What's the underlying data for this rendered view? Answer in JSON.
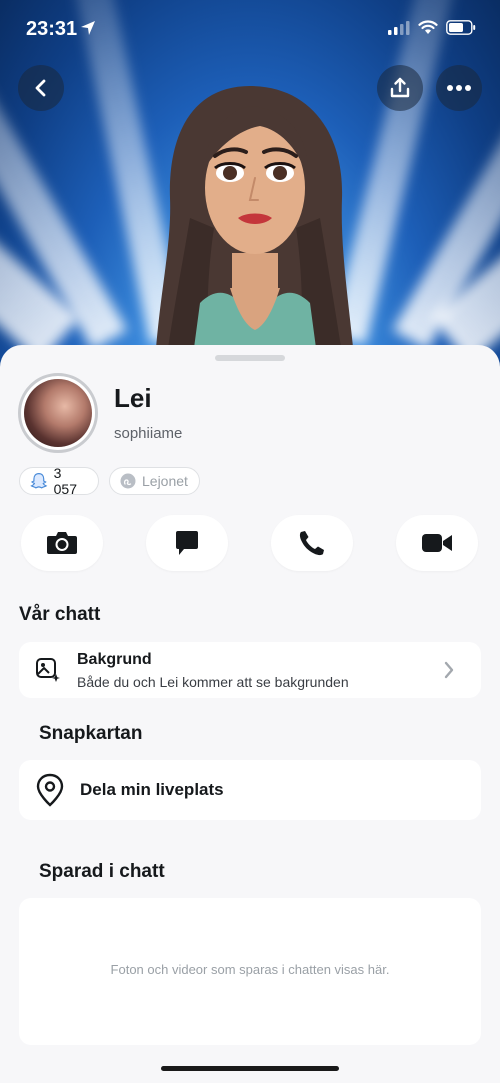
{
  "status_bar": {
    "time": "23:31"
  },
  "profile": {
    "name": "Lei",
    "username": "sophiiame",
    "snap_score": "3 057",
    "zodiac": "Lejonet"
  },
  "actions": [
    {
      "icon": "camera-icon"
    },
    {
      "icon": "chat-icon"
    },
    {
      "icon": "phone-icon"
    },
    {
      "icon": "video-call-icon"
    }
  ],
  "our_chat": {
    "title": "Vår chatt",
    "background_title": "Bakgrund",
    "background_subtitle": "Både du och Lei kommer att se bakgrunden"
  },
  "snap_map": {
    "title": "Snapkartan",
    "share_label": "Dela min liveplats"
  },
  "saved_in_chat": {
    "title": "Sparad i chatt",
    "empty_text": "Foton och videor som sparas i chatten visas här."
  },
  "colors": {
    "accent_bg": "#1d5fb8",
    "sheet_bg": "#f7f7f9"
  }
}
